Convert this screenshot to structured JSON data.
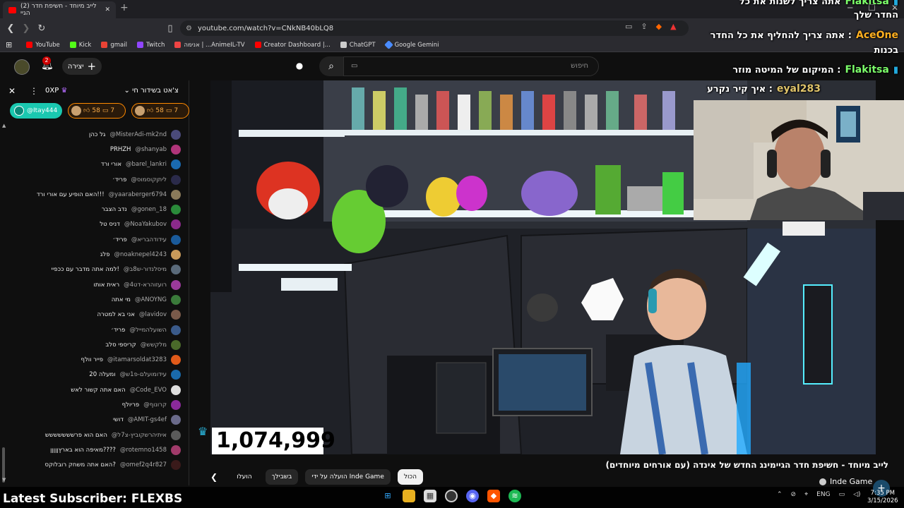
{
  "browser": {
    "tab_title": "(2) לייב מיוחד - חשיפת חדר הגיי",
    "url": "youtube.com/watch?v=CNkNB40bLQ8",
    "bookmarks": [
      {
        "label": "YouTube",
        "color": "#ff0000"
      },
      {
        "label": "Kick",
        "color": "#53fc18"
      },
      {
        "label": "gmail",
        "color": "#ea4335"
      },
      {
        "label": "Twitch",
        "color": "#9146ff"
      },
      {
        "label": "אנימה | ...AnimeIL-TV",
        "color": "#e44"
      },
      {
        "label": "Creator Dashboard |...",
        "color": "#ff0000"
      },
      {
        "label": "ChatGPT",
        "color": "#ccc"
      },
      {
        "label": "Google Gemini",
        "color": "#4a8cff"
      }
    ]
  },
  "youtube": {
    "create_label": "יצירה",
    "notifications_count": "2",
    "search_placeholder": "חיפוש"
  },
  "chat": {
    "title": "צ'אט בשידור חי",
    "xp": "0XP",
    "pinned": [
      {
        "label": "@Itay444"
      },
      {
        "likes": "58",
        "comments": "7"
      },
      {
        "likes": "58",
        "comments": "7"
      }
    ],
    "messages": [
      {
        "name": "@MisterAdi-mk2nd",
        "text": "גל כהן",
        "color": "#4a4a7a"
      },
      {
        "name": "@shanyab",
        "text": "PRHZH",
        "color": "#b0357a"
      },
      {
        "name": "@barel_lankri",
        "text": "אורי ורד",
        "color": "#1a6ab0"
      },
      {
        "name": "@ליתןקוסמוס",
        "text": "פריד׳",
        "color": "#2a2a4a"
      },
      {
        "name": "@yaaraberger6794",
        "text": "האם הופיע עם אורי ורד!!!",
        "color": "#8a7a5a"
      },
      {
        "name": "@gonen_18",
        "text": "נדב הצבר",
        "color": "#2a8a3a"
      },
      {
        "name": "@NoaYakubov",
        "text": "דניס טל",
        "color": "#8a2a8a"
      },
      {
        "name": "@עידודהבריא",
        "text": "פריד׳",
        "color": "#1a5a9a"
      },
      {
        "name": "@noaknepel4243",
        "text": "פלג",
        "color": "#c89a5a"
      },
      {
        "name": "@מיסלנדור-ש8ב",
        "text": "למה אתה מדבר עם ככפיי!",
        "color": "#5a6a7a"
      },
      {
        "name": "@רועזוהרא-דט4",
        "text": "ראית אותו",
        "color": "#9a3a9a"
      },
      {
        "name": "@ANOYNG",
        "text": "מי אתה",
        "color": "#3a7a3a"
      },
      {
        "name": "@lavidov",
        "text": "אני בא למטרה",
        "color": "#7a5a4a"
      },
      {
        "name": "@השועלהמייל",
        "text": "פריד׳",
        "color": "#3a5a8a"
      },
      {
        "name": "@מלקשש",
        "text": "קריספי סלב",
        "color": "#4a6a2a"
      },
      {
        "name": "@itamarsoldat3283",
        "text": "פייר וולף",
        "color": "#e05a1a"
      },
      {
        "name": "@עידומועלם-פ1ש",
        "text": "20 ומעלה",
        "color": "#1a6aaa"
      },
      {
        "name": "@Code_EVO",
        "text": "האם אתה קשור לאש",
        "color": "#ddd"
      },
      {
        "name": "@קרונוף",
        "text": "פריולף",
        "color": "#8a2a9a"
      },
      {
        "name": "@AMIT-gs4ef",
        "text": "דושי",
        "color": "#6a6a8a"
      },
      {
        "name": "@איתיהרשקוביץ-צ7ל",
        "text": "האם הוא פרששששששש",
        "color": "#5a5a5a"
      },
      {
        "name": "@rotemno1458",
        "text": "מאיפה הוא בארץןןןןן????",
        "color": "#a03a6a"
      },
      {
        "name": "@omef2q4r827",
        "text": "האם אתה משחק רובלוקס?",
        "color": "#3a1a1a"
      }
    ]
  },
  "video": {
    "counter": "1,074,999",
    "title": "לייב מיוחד - חשיפת חדר הגיימינג החדש של אינדה (עם אורחים מיוחדים)",
    "channel": "Inde Game",
    "chips": [
      {
        "label": "הכול",
        "active": true
      },
      {
        "label": "הועלה על ידי Inde Game",
        "active": false
      },
      {
        "label": "בשבילך",
        "active": false
      },
      {
        "label": "הועלו",
        "active": false
      }
    ]
  },
  "overlay_chat": [
    {
      "name": "Flakitsa",
      "text": "אתה צריך לשנות את כל",
      "name_color": "#7cff6a"
    },
    {
      "name": "",
      "text": "החדר שלך",
      "name_color": "#fff"
    },
    {
      "name": "AceOne",
      "text": "אתה צריך להחליף את כל החדר :",
      "name_color": "#ffb020"
    },
    {
      "name": "",
      "text": "בכנות",
      "name_color": "#fff"
    },
    {
      "name": "Flakitsa",
      "text": "המיקום של המיטה מוזר :",
      "name_color": "#7cff6a"
    },
    {
      "name": "eyal283",
      "text": "איך קיר נקרע :",
      "name_color": "#e0c46a"
    }
  ],
  "stream_overlay": {
    "latest_subscriber": "Latest Subscriber: FLEXBS"
  },
  "taskbar": {
    "lang": "ENG",
    "time": "7:35 PM",
    "date": "3/15/2026"
  }
}
